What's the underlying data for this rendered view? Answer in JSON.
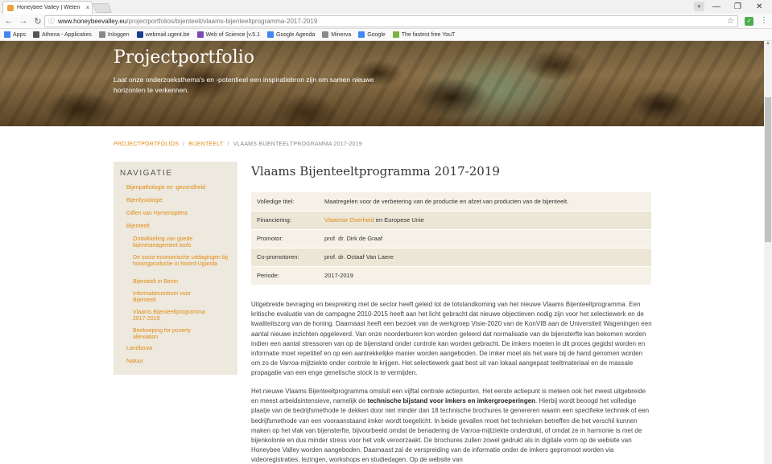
{
  "browser": {
    "tab_title": "Honeybee Valley | Weten",
    "tab_close": "×",
    "url_host": "www.honeybeevalley.eu",
    "url_path": "/projectportfolios/bijenteelt/vlaams-bijenteeltprogramma-2017-2019",
    "bookmarks": [
      "Apps",
      "Athena - Applicaties",
      "Inloggen",
      "webmail.ugent.be",
      "Web of Science [v.5.1",
      "Google Agenda",
      "Minerva",
      "Google",
      "The fastest free YouT"
    ],
    "bookmark_colors": [
      "#4285f4",
      "#555555",
      "#888888",
      "#1a3e8c",
      "#7a4bb5",
      "#4285f4",
      "#8a8a8a",
      "#4285f4",
      "#7cb342"
    ]
  },
  "hero": {
    "title": "Projectportfolio",
    "subtitle": "Laat onze onderzoeksthema's en -potentieel een inspiratiebron zijn om samen nieuwe horizonten te verkennen."
  },
  "breadcrumb": {
    "items": [
      "PROJECTPORTFOLIOS",
      "BIJENTEELT",
      "VLAAMS BIJENTEELTPROGRAMMA 2017-2019"
    ],
    "separator": "/"
  },
  "sidenav": {
    "heading": "NAVIGATIE",
    "items": [
      {
        "label": "Bijenpathologie en -gezondheid"
      },
      {
        "label": "Bijenfysiologie"
      },
      {
        "label": "Giffen van Hymenoptera"
      },
      {
        "label": "Bijenteelt"
      },
      {
        "label": "Ontwikkeling van goede bijenmanagement tools"
      },
      {
        "label": "De socio-economische uitdagingen bij honingproductie in Noord-Uganda"
      },
      {
        "label": "Bijenteelt in Benin"
      },
      {
        "label": "Informatiecentrum voor Bijenteelt"
      },
      {
        "label": "Vlaams Bijenteeltprogramma 2017-2019"
      },
      {
        "label": "Beekeeping for poverty alleviation"
      },
      {
        "label": "Landbouw"
      },
      {
        "label": "Natuur"
      }
    ]
  },
  "main": {
    "title": "Vlaams Bijenteeltprogramma 2017-2019",
    "table": [
      {
        "key": "Volledige titel:",
        "value": "Maatregelen voor de verbetering van de productie en afzet van producten van de bijenteelt."
      },
      {
        "key": "Financiering:",
        "link": "Vlaamse Overheid",
        "value": " en Europese Unie"
      },
      {
        "key": "Promotor:",
        "value": "prof. dr. Dirk de Graaf"
      },
      {
        "key": "Co-promotoren:",
        "value": "prof. dr. Octaaf Van Laere"
      },
      {
        "key": "Periode:",
        "value": "2017-2019"
      }
    ],
    "para1": "Uitgebreide bevraging en bespreking met de sector heeft geleid tot de totstandkoming van het nieuwe Vlaams Bijenteeltprogramma. Een kritische evaluatie van de campagne 2010-2015 heeft aan het licht gebracht dat nieuwe objectieven nodig zijn voor het selectiewerk en de kwaliteitszorg van de honing. Daarnaast heeft een bezoek van de werkgroep Visie-2020 van de KonVIB aan de Universiteit Wageningen een aantal nieuwe inzichten opgeleverd. Van onze noorderburen kon worden geleerd dat normalisatie van de bijensterfte kan bekomen worden indien een aantal stressoren van op de bijenstand onder controle kan worden gebracht. De imkers moeten in dit proces gegidst worden en informatie moet repetitief en op een aantrekkelijke manier worden aangeboden. De imker moet als het ware bij de hand genomen worden om zo de Varroa-mijtziekte onder controle te krijgen. Het selectiewerk gaat best uit van lokaal aangepast teeltmateriaal en de massale propagatie van een enge genetische stock is te vermijden.",
    "para2_a": "Het nieuwe Vlaams Bijenteeltprogramma omsluit een vijftal centrale actiepunten. Het eerste actiepunt is meteen ook het meest uitgebreide en meest arbeidsintensieve, namelijk de ",
    "para2_bold": "technische bijstand voor imkers en imkergroeperingen",
    "para2_b": ". Hierbij wordt beoogd het volledige plaatje van de bedrijfsmethode te dekken door niet minder dan 18 technische brochures te genereren waarin een specifieke techniek of een bedrijfsmethode van een vooraanstaand imker wordt toegelicht. In beide gevallen moet het technieken betreffen die het verschil kunnen maken op het vlak van bijensterfte, bijvoorbeeld omdat de benadering de Varroa-mijtziekte onderdrukt, of omdat ze in harmonie is met de bijenkolonie en dus minder stress voor het volk veroorzaakt. De brochures zullen zowel gedrukt als in digitale vorm op de website van Honeybee Valley worden aangeboden. Daarnaast zal de verspreiding van de informatie onder de imkers gepromoot worden via videoregistraties, lezingen, workshops en studiedagen. Op de website van"
  }
}
